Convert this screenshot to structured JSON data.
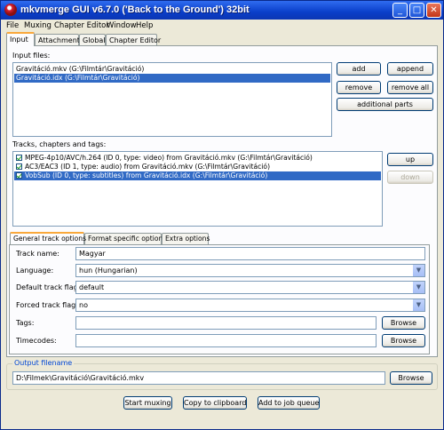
{
  "window": {
    "title": "mkvmerge GUI v6.7.0 ('Back to the Ground') 32bit"
  },
  "title_buttons": {
    "minimize": "_",
    "maximize": "□",
    "close": "✕"
  },
  "menu": [
    "File",
    "Muxing",
    "Chapter Editor",
    "Window",
    "Help"
  ],
  "tabs": [
    "Input",
    "Attachments",
    "Global",
    "Chapter Editor"
  ],
  "input_files": {
    "label": "Input files:",
    "items": [
      "Gravitáció.mkv (G:\\Filmtár\\Gravitáció)",
      "Gravitáció.idx (G:\\Filmtár\\Gravitáció)"
    ],
    "selected_index": 1
  },
  "file_buttons": {
    "add": "add",
    "append": "append",
    "remove": "remove",
    "remove_all": "remove all",
    "additional_parts": "additional parts"
  },
  "tracks": {
    "label": "Tracks, chapters and tags:",
    "items": [
      "MPEG-4p10/AVC/h.264 (ID 0, type: video) from Gravitáció.mkv (G:\\Filmtár\\Gravitáció)",
      "AC3/EAC3 (ID 1, type: audio) from Gravitáció.mkv (G:\\Filmtár\\Gravitáció)",
      "VobSub (ID 0, type: subtitles) from Gravitáció.idx (G:\\Filmtár\\Gravitáció)"
    ],
    "checked": [
      true,
      true,
      true
    ],
    "selected_index": 2
  },
  "track_buttons": {
    "up": "up",
    "down": "down"
  },
  "sub_tabs": [
    "General track options",
    "Format specific options",
    "Extra options"
  ],
  "general_options": {
    "track_name": {
      "label": "Track name:",
      "value": "Magyar"
    },
    "language": {
      "label": "Language:",
      "value": "hun (Hungarian)"
    },
    "default_flag": {
      "label": "Default track flag:",
      "value": "default"
    },
    "forced_flag": {
      "label": "Forced track flag:",
      "value": "no"
    },
    "tags": {
      "label": "Tags:",
      "value": "",
      "browse": "Browse"
    },
    "timecodes": {
      "label": "Timecodes:",
      "value": "",
      "browse": "Browse"
    }
  },
  "output": {
    "group_label": "Output filename",
    "value": "D:\\Filmek\\Gravitáció\\Gravitáció.mkv",
    "browse": "Browse"
  },
  "actions": {
    "start_muxing": "Start muxing",
    "copy_to_clipboard": "Copy to clipboard",
    "add_to_job_queue": "Add to job queue"
  },
  "icons": {
    "app": "mkvmerge-icon",
    "combo_arrow": "chevron-down-icon",
    "check": "checkmark-icon"
  }
}
